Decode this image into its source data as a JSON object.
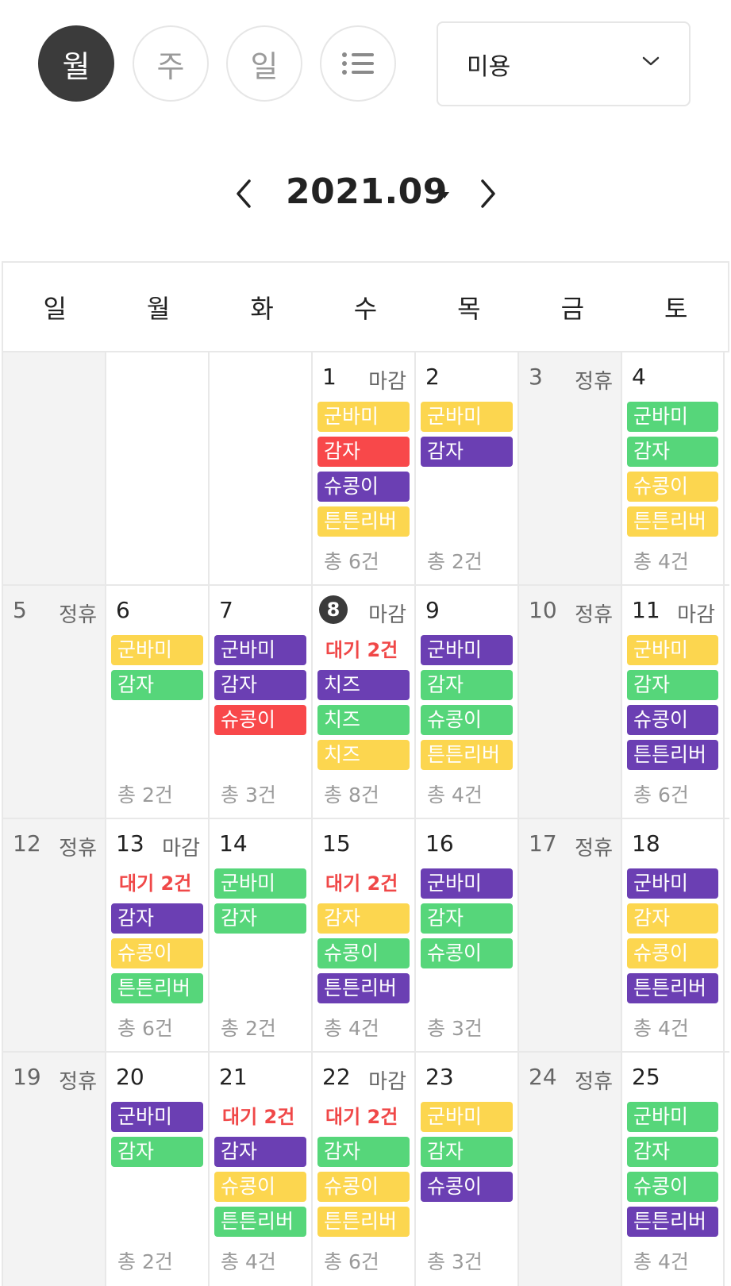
{
  "view_toggle": [
    {
      "label": "월",
      "active": true
    },
    {
      "label": "주",
      "active": false
    },
    {
      "label": "일",
      "active": false
    },
    {
      "label": "list-icon",
      "active": false
    }
  ],
  "category_select": {
    "value": "미용",
    "icon": "chevron-down-icon"
  },
  "month_nav": {
    "label": "2021.09",
    "prev_icon": "chevron-left-icon",
    "next_icon": "chevron-right-icon",
    "caret_icon": "caret-down-icon"
  },
  "colors": {
    "yellow": "#fcd64f",
    "red": "#f8484a",
    "purple": "#6b3fb3",
    "green": "#56d67a",
    "pending": "#f04848",
    "today": "#3b3b3b",
    "closed_bg": "#f3f3f3"
  },
  "weekdays": [
    "일",
    "월",
    "화",
    "수",
    "목",
    "금",
    "토"
  ],
  "weeks": [
    [
      {
        "day": "",
        "tag": "",
        "closed": true,
        "events": [],
        "total": ""
      },
      {
        "day": "",
        "tag": "",
        "events": [],
        "total": ""
      },
      {
        "day": "",
        "tag": "",
        "events": [],
        "total": ""
      },
      {
        "day": "1",
        "tag": "마감",
        "events": [
          {
            "label": "군바미",
            "color": "yellow"
          },
          {
            "label": "감자",
            "color": "red"
          },
          {
            "label": "슈콩이",
            "color": "purple"
          },
          {
            "label": "튼튼리버",
            "color": "yellow"
          }
        ],
        "total": "총 6건"
      },
      {
        "day": "2",
        "tag": "",
        "events": [
          {
            "label": "군바미",
            "color": "yellow"
          },
          {
            "label": "감자",
            "color": "purple"
          }
        ],
        "total": "총 2건"
      },
      {
        "day": "3",
        "tag": "정휴",
        "closed": true,
        "events": [],
        "total": ""
      },
      {
        "day": "4",
        "tag": "",
        "events": [
          {
            "label": "군바미",
            "color": "green"
          },
          {
            "label": "감자",
            "color": "green"
          },
          {
            "label": "슈콩이",
            "color": "yellow"
          },
          {
            "label": "튼튼리버",
            "color": "yellow"
          }
        ],
        "total": "총 4건"
      }
    ],
    [
      {
        "day": "5",
        "tag": "정휴",
        "closed": true,
        "events": [],
        "total": ""
      },
      {
        "day": "6",
        "tag": "",
        "events": [
          {
            "label": "군바미",
            "color": "yellow"
          },
          {
            "label": "감자",
            "color": "green"
          }
        ],
        "total": "총 2건"
      },
      {
        "day": "7",
        "tag": "",
        "events": [
          {
            "label": "군바미",
            "color": "purple"
          },
          {
            "label": "감자",
            "color": "purple"
          },
          {
            "label": "슈콩이",
            "color": "red"
          }
        ],
        "total": "총 3건"
      },
      {
        "day": "8",
        "today": true,
        "tag": "마감",
        "pending": "대기 2건",
        "events": [
          {
            "label": "치즈",
            "color": "purple"
          },
          {
            "label": "치즈",
            "color": "green"
          },
          {
            "label": "치즈",
            "color": "yellow"
          }
        ],
        "total": "총 8건"
      },
      {
        "day": "9",
        "tag": "",
        "events": [
          {
            "label": "군바미",
            "color": "purple"
          },
          {
            "label": "감자",
            "color": "green"
          },
          {
            "label": "슈콩이",
            "color": "green"
          },
          {
            "label": "튼튼리버",
            "color": "yellow"
          }
        ],
        "total": "총 4건"
      },
      {
        "day": "10",
        "tag": "정휴",
        "closed": true,
        "events": [],
        "total": ""
      },
      {
        "day": "11",
        "tag": "마감",
        "events": [
          {
            "label": "군바미",
            "color": "yellow"
          },
          {
            "label": "감자",
            "color": "green"
          },
          {
            "label": "슈콩이",
            "color": "purple"
          },
          {
            "label": "튼튼리버",
            "color": "purple"
          }
        ],
        "total": "총 6건"
      }
    ],
    [
      {
        "day": "12",
        "tag": "정휴",
        "closed": true,
        "events": [],
        "total": ""
      },
      {
        "day": "13",
        "tag": "마감",
        "pending": "대기 2건",
        "events": [
          {
            "label": "감자",
            "color": "purple"
          },
          {
            "label": "슈콩이",
            "color": "yellow"
          },
          {
            "label": "튼튼리버",
            "color": "green"
          }
        ],
        "total": "총 6건"
      },
      {
        "day": "14",
        "tag": "",
        "events": [
          {
            "label": "군바미",
            "color": "green"
          },
          {
            "label": "감자",
            "color": "green"
          }
        ],
        "total": "총 2건"
      },
      {
        "day": "15",
        "tag": "",
        "pending": "대기 2건",
        "events": [
          {
            "label": "감자",
            "color": "yellow"
          },
          {
            "label": "슈콩이",
            "color": "green"
          },
          {
            "label": "튼튼리버",
            "color": "purple"
          }
        ],
        "total": "총 4건"
      },
      {
        "day": "16",
        "tag": "",
        "events": [
          {
            "label": "군바미",
            "color": "purple"
          },
          {
            "label": "감자",
            "color": "green"
          },
          {
            "label": "슈콩이",
            "color": "green"
          }
        ],
        "total": "총 3건"
      },
      {
        "day": "17",
        "tag": "정휴",
        "closed": true,
        "events": [],
        "total": ""
      },
      {
        "day": "18",
        "tag": "",
        "events": [
          {
            "label": "군바미",
            "color": "purple"
          },
          {
            "label": "감자",
            "color": "yellow"
          },
          {
            "label": "슈콩이",
            "color": "yellow"
          },
          {
            "label": "튼튼리버",
            "color": "purple"
          }
        ],
        "total": "총 4건"
      }
    ],
    [
      {
        "day": "19",
        "tag": "정휴",
        "closed": true,
        "events": [],
        "total": ""
      },
      {
        "day": "20",
        "tag": "",
        "events": [
          {
            "label": "군바미",
            "color": "purple"
          },
          {
            "label": "감자",
            "color": "green"
          }
        ],
        "total": "총 2건"
      },
      {
        "day": "21",
        "tag": "",
        "pending": "대기 2건",
        "events": [
          {
            "label": "감자",
            "color": "purple"
          },
          {
            "label": "슈콩이",
            "color": "yellow"
          },
          {
            "label": "튼튼리버",
            "color": "green"
          }
        ],
        "total": "총 4건"
      },
      {
        "day": "22",
        "tag": "마감",
        "pending": "대기 2건",
        "events": [
          {
            "label": "감자",
            "color": "green"
          },
          {
            "label": "슈콩이",
            "color": "yellow"
          },
          {
            "label": "튼튼리버",
            "color": "yellow"
          }
        ],
        "total": "총 6건"
      },
      {
        "day": "23",
        "tag": "",
        "events": [
          {
            "label": "군바미",
            "color": "yellow"
          },
          {
            "label": "감자",
            "color": "green"
          },
          {
            "label": "슈콩이",
            "color": "purple"
          }
        ],
        "total": "총 3건"
      },
      {
        "day": "24",
        "tag": "정휴",
        "closed": true,
        "events": [],
        "total": ""
      },
      {
        "day": "25",
        "tag": "",
        "events": [
          {
            "label": "군바미",
            "color": "green"
          },
          {
            "label": "감자",
            "color": "green"
          },
          {
            "label": "슈콩이",
            "color": "green"
          },
          {
            "label": "튼튼리버",
            "color": "purple"
          }
        ],
        "total": "총 4건"
      }
    ]
  ]
}
